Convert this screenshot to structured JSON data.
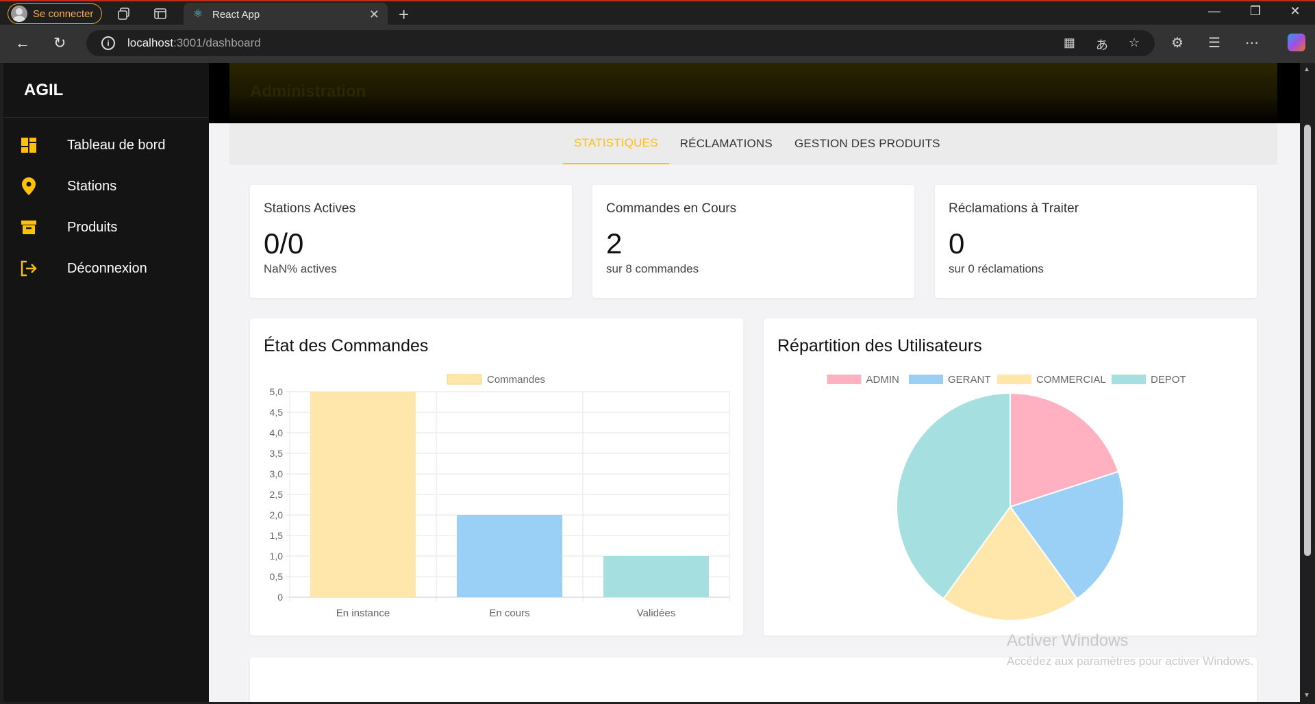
{
  "browser": {
    "profile_label": "Se connecter",
    "tab_title": "React App",
    "url_host": "localhost",
    "url_path": ":3001/dashboard"
  },
  "app": {
    "brand": "AGIL",
    "header_title": "Administration",
    "sidebar": {
      "items": [
        {
          "label": "Tableau de bord",
          "icon": "dashboard-icon"
        },
        {
          "label": "Stations",
          "icon": "map-pin-icon"
        },
        {
          "label": "Produits",
          "icon": "archive-box-icon"
        },
        {
          "label": "Déconnexion",
          "icon": "logout-icon"
        }
      ]
    },
    "tabs": [
      {
        "label": "STATISTIQUES",
        "active": true
      },
      {
        "label": "RÉCLAMATIONS",
        "active": false
      },
      {
        "label": "GESTION DES PRODUITS",
        "active": false
      }
    ],
    "stats": [
      {
        "title": "Stations Actives",
        "value": "0/0",
        "sub": "NaN% actives"
      },
      {
        "title": "Commandes en Cours",
        "value": "2",
        "sub": "sur 8 commandes"
      },
      {
        "title": "Réclamations à Traiter",
        "value": "0",
        "sub": "sur 0 réclamations"
      }
    ],
    "accent_color": "#ffc107"
  },
  "chart_data": [
    {
      "type": "bar",
      "title": "État des Commandes",
      "categories": [
        "En instance",
        "En cours",
        "Validées"
      ],
      "series": [
        {
          "name": "Commandes",
          "values": [
            5,
            2,
            1
          ]
        }
      ],
      "colors": [
        "#ffe6aa",
        "#9ad0f5",
        "#a5dfdf"
      ],
      "ylim": [
        0,
        5
      ],
      "yticks": [
        "0",
        "0,5",
        "1,0",
        "1,5",
        "2,0",
        "2,5",
        "3,0",
        "3,5",
        "4,0",
        "4,5",
        "5,0"
      ],
      "grid": true,
      "legend": "top"
    },
    {
      "type": "pie",
      "title": "Répartition des Utilisateurs",
      "labels": [
        "ADMIN",
        "GERANT",
        "COMMERCIAL",
        "DEPOT"
      ],
      "values": [
        1,
        1,
        1,
        2
      ],
      "colors": [
        "#ffb1c1",
        "#9ad0f5",
        "#ffe6aa",
        "#a5dfdf"
      ],
      "legend": "top"
    }
  ],
  "watermark": {
    "title": "Activer Windows",
    "subtitle": "Accédez aux paramètres pour activer Windows."
  }
}
